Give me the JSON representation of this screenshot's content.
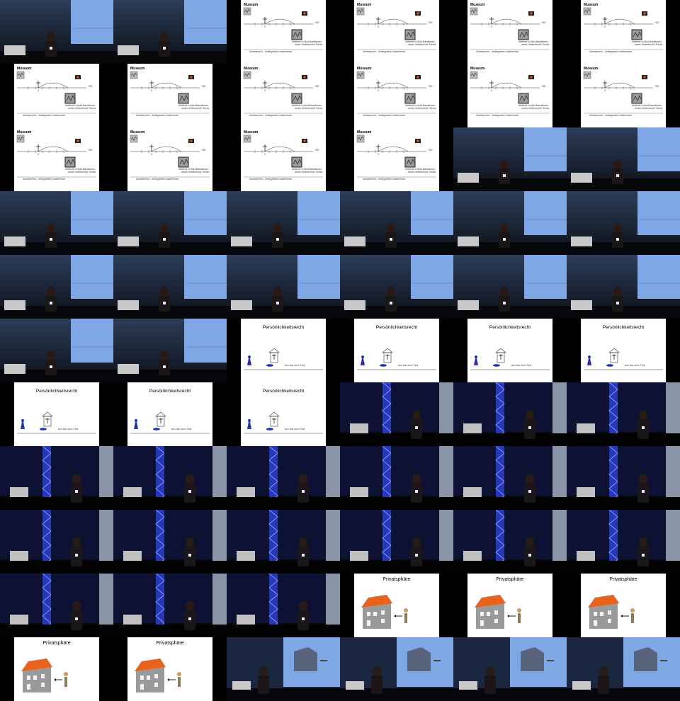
{
  "texts": {
    "museum": "Museum",
    "persoenlichkeitsrecht": "Persönlichkeitsrecht",
    "privatsphaere": "Privatsphäre",
    "bis_zum_tod": "nur bis zum Tod",
    "plus_dd": "+DD",
    "museum_note_1": "vielleicht in Nicht-Mainstream ...",
    "museum_note_2": "→ neues Urheberrecht-Thema",
    "museum_footer": "Urheberrecht -- festlegendes Urheberrecht",
    "zero_mark": "0"
  },
  "layout": {
    "columns": 6,
    "rows": 11
  },
  "tiles": [
    "stage-left-screen",
    "stage-left-screen",
    "museum-slide",
    "museum-slide",
    "museum-slide",
    "museum-slide",
    "museum-slide",
    "museum-slide",
    "museum-slide",
    "museum-slide",
    "museum-slide",
    "museum-slide",
    "museum-slide",
    "museum-slide",
    "museum-slide",
    "museum-slide",
    "stage-left-screen",
    "stage-left-screen",
    "stage-left-screen",
    "stage-left-screen",
    "stage-left-screen",
    "stage-left-screen",
    "stage-left-screen",
    "stage-left-screen",
    "stage-left-screen",
    "stage-left-screen",
    "stage-left-screen",
    "stage-left-screen",
    "stage-left-screen",
    "stage-left-screen",
    "stage-left-screen",
    "stage-left-screen",
    "pers-slide",
    "pers-slide",
    "pers-slide",
    "pers-slide",
    "pers-slide",
    "pers-slide",
    "pers-slide",
    "stage-truss",
    "stage-truss",
    "stage-truss",
    "stage-truss",
    "stage-truss",
    "stage-truss",
    "stage-truss",
    "stage-truss",
    "stage-truss",
    "stage-truss",
    "stage-truss",
    "stage-truss",
    "stage-truss",
    "stage-truss",
    "stage-truss",
    "stage-truss",
    "stage-truss",
    "stage-truss",
    "priv-slide",
    "priv-slide",
    "priv-slide",
    "priv-slide",
    "priv-slide",
    "stage-house-screen",
    "stage-house-screen",
    "stage-house-screen",
    "stage-house-screen"
  ],
  "colors": {
    "black": "#000000",
    "stage_dark": "#1a2230",
    "screen_blue": "#7fa7e6",
    "truss_blue": "#2d3fcf",
    "slide_white": "#ffffff",
    "roof_orange": "#e8621c",
    "house_gray": "#9a9a9a",
    "figure_blue": "#2233aa"
  }
}
